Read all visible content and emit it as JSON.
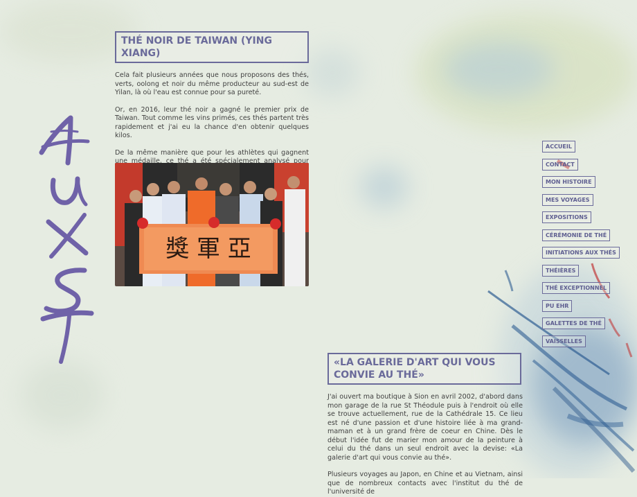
{
  "colors": {
    "accent": "#6a6a9a",
    "background": "#e6ece2",
    "text": "#404040",
    "logo": "#6f62a8",
    "ink_blue": "#2f5e93",
    "ink_red": "#c23a3a"
  },
  "logo": {
    "alt": "AU XS T",
    "icon": "calligraphy-logo"
  },
  "section1": {
    "title": "THÉ NOIR DE TAIWAN (YING XIANG)",
    "paragraphs": [
      "Cela fait plusieurs années que nous proposons des thés, verts, oolong et noir du même producteur au sud-est de Yilan, là où l'eau est connue pour sa pureté.",
      "Or, en 2016, leur thé noir a gagné le premier prix de Taiwan. Tout comme les vins primés, ces thés partent très rapidement et j'ai eu la chance d'en obtenir quelques kilos.",
      "De la même manière que pour les athlètes qui gagnent une médaille, ce thé a été spécialement analysé pour prouver toute absence de dopage (pesticide, engrais illégaux, etc.)."
    ],
    "photo": {
      "banner_text": "獎 軍 亞",
      "description": "group-photo"
    }
  },
  "section2": {
    "title": "«LA GALERIE D'ART QUI VOUS CONVIE AU THÉ»",
    "paragraphs": [
      "J'ai ouvert ma boutique à Sion en avril 2002, d'abord dans mon garage de la rue St Théodule puis à l'endroit où elle se trouve actuellement, rue de la Cathédrale 15. Ce lieu est né d'une passion et d'une histoire liée à ma grand-maman et à un grand frère de coeur en Chine. Dès le début l'idée fut de marier mon amour de la peinture à celui du thé dans un seul endroit avec la devise: «La galerie d'art qui vous convie au thé».",
      "Plusieurs voyages au Japon, en Chine et au Vietnam, ainsi que de nombreux contacts avec l'institut du thé de l'université de"
    ]
  },
  "nav": {
    "items": [
      "ACCUEIL",
      "CONTACT",
      "MON HISTOIRE",
      "MES VOYAGES",
      "EXPOSITIONS",
      "CÉRÉMONIE DE THÉ",
      "INITIATIONS AUX THÉS",
      "THÉIÈRES",
      "THÉ EXCEPTIONNEL",
      "PU EHR",
      "GALETTES DE THÉ",
      "VAISSELLES"
    ]
  }
}
